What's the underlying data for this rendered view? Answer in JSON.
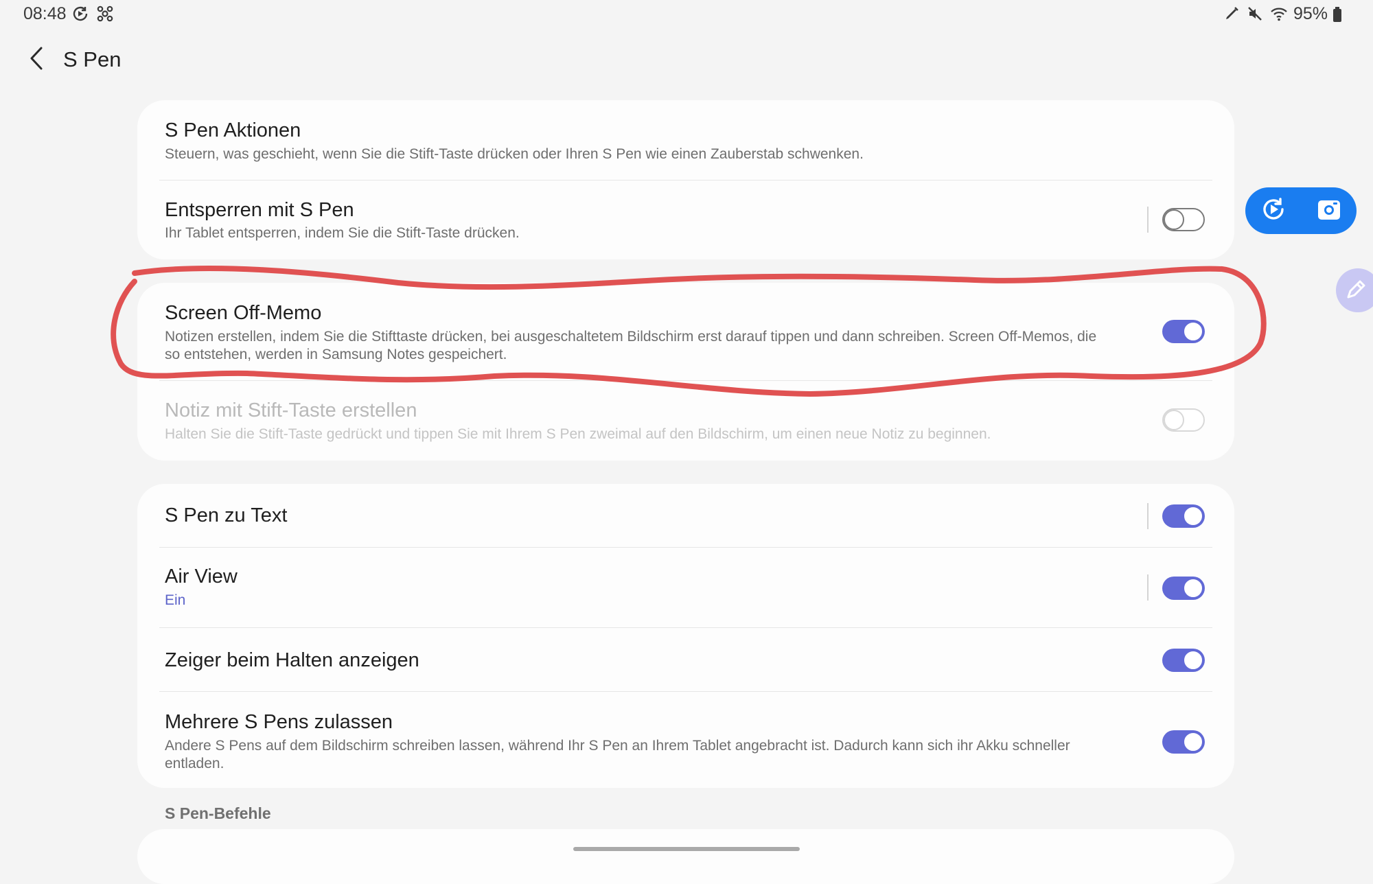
{
  "status_bar": {
    "time": "08:48",
    "left_icons": [
      "screen-recorder-icon",
      "bixby-routines-icon"
    ],
    "right_icons": [
      "s-pen-icon",
      "mute-icon",
      "wifi-icon",
      "battery-icon"
    ],
    "battery": "95%"
  },
  "header": {
    "back_icon": "chevron-left-icon",
    "title": "S Pen"
  },
  "groups": [
    {
      "rows": [
        {
          "title": "S Pen Aktionen",
          "subtitle": "Steuern, was geschieht, wenn Sie die Stift-Taste drücken oder Ihren S Pen wie einen Zauberstab schwenken."
        },
        {
          "title": "Entsperren mit S Pen",
          "subtitle": "Ihr Tablet entsperren, indem Sie die Stift-Taste drücken.",
          "toggle": "off"
        }
      ]
    },
    {
      "rows": [
        {
          "title": "Screen Off-Memo",
          "subtitle_line1": "Notizen erstellen, indem Sie die Stifttaste drücken, bei ausgeschaltetem Bildschirm erst darauf tippen und dann schreiben. Screen Off-Memos, die",
          "subtitle_line2": "so entstehen, werden in Samsung Notes gespeichert.",
          "toggle": "on"
        },
        {
          "title": "Notiz mit Stift-Taste erstellen",
          "subtitle": "Halten Sie die Stift-Taste gedrückt und tippen Sie mit Ihrem S Pen zweimal auf den Bildschirm, um einen neue Notiz zu beginnen.",
          "toggle": "disabled"
        }
      ]
    },
    {
      "rows": [
        {
          "title": "S Pen zu Text",
          "toggle": "on"
        },
        {
          "title": "Air View",
          "subtitle": "Ein",
          "toggle": "on"
        },
        {
          "title": "Zeiger beim Halten anzeigen",
          "toggle": "on"
        },
        {
          "title": "Mehrere S Pens zulassen",
          "subtitle_line1": "Andere S Pens auf dem Bildschirm schreiben lassen, während Ihr S Pen an Ihrem Tablet angebracht ist. Dadurch kann sich ihr Akku schneller",
          "subtitle_line2": "entladen.",
          "toggle": "on"
        }
      ]
    }
  ],
  "section_header": "S Pen-Befehle",
  "floating": {
    "capture_icons": [
      "screen-record-icon",
      "screenshot-icon"
    ],
    "pen_icon": "edit-pen-icon"
  },
  "colors": {
    "accent": "#6169d6",
    "capture_widget": "#1a7df0",
    "annotation": "#e05252",
    "background": "#f4f4f4"
  }
}
